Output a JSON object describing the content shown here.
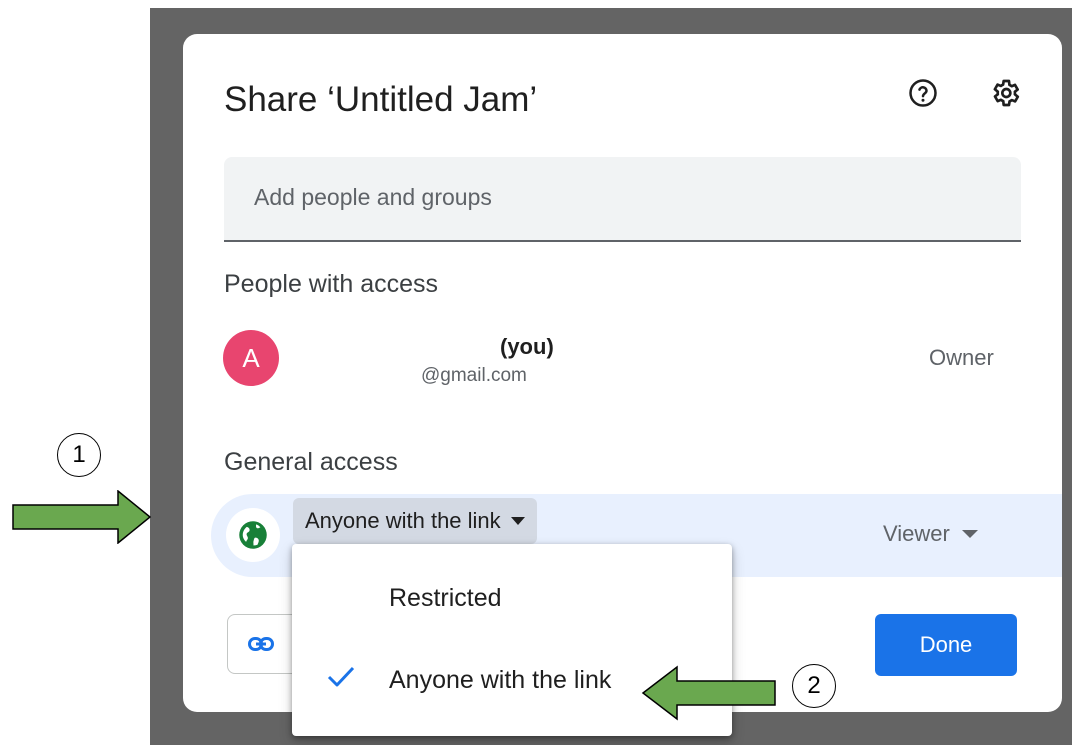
{
  "dialog": {
    "title": "Share ‘Untitled Jam’",
    "help_icon": "help-circle-icon",
    "settings_icon": "gear-icon",
    "add_people_placeholder": "Add people and groups"
  },
  "people": {
    "heading": "People with access",
    "owner": {
      "avatar_letter": "A",
      "avatar_color": "#e8456f",
      "name": "(you)",
      "email": "@gmail.com",
      "role": "Owner"
    }
  },
  "general": {
    "heading": "General access",
    "icon": "globe-icon",
    "access_value": "Anyone with the link",
    "role_value": "Viewer"
  },
  "dropdown": {
    "items": [
      {
        "label": "Restricted",
        "selected": false
      },
      {
        "label": "Anyone with the link",
        "selected": true
      }
    ]
  },
  "footer": {
    "copy_link_icon": "link-icon",
    "done_label": "Done"
  },
  "annotations": {
    "step1": "1",
    "step2": "2",
    "arrow_color": "#6aa84f"
  },
  "colors": {
    "accent": "#1a73e8",
    "row_highlight": "#e8f0fe",
    "globe": "#188038",
    "backdrop": "#646464"
  }
}
